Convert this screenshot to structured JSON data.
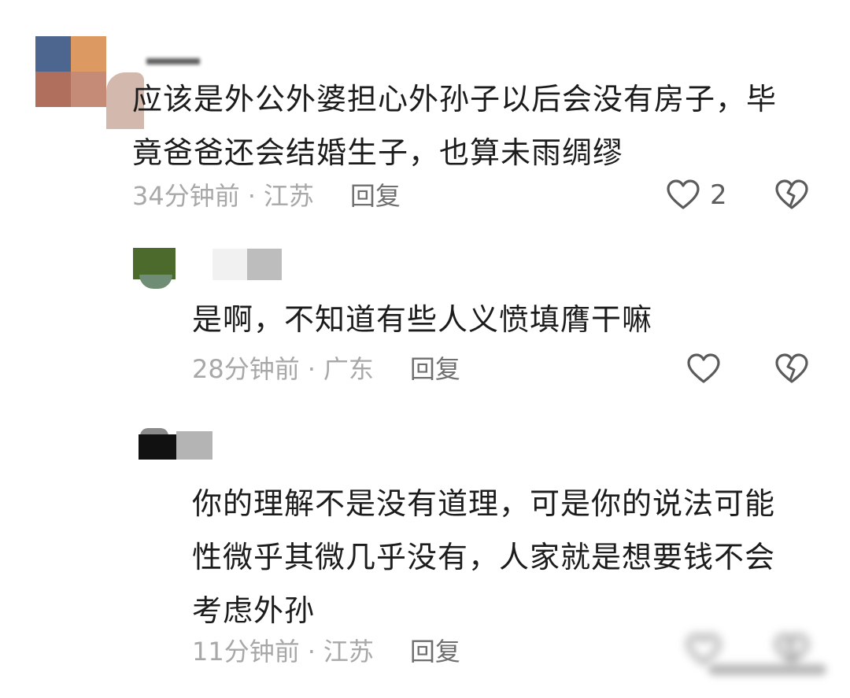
{
  "comments": [
    {
      "text_lines": [
        "应该是外公外婆担心外孙子以后会没有房子，毕",
        "竟爸爸还会结婚生子，也算未雨绸缪"
      ],
      "time": "34分钟前",
      "location": "江苏",
      "reply_label": "回复",
      "like_count": "2"
    },
    {
      "text_lines": [
        "是啊，不知道有些人义愤填膺干嘛"
      ],
      "time": "28分钟前",
      "location": "广东",
      "reply_label": "回复",
      "like_count": ""
    },
    {
      "text_lines": [
        "你的理解不是没有道理，可是你的说法可能",
        "性微乎其微几乎没有，人家就是想要钱不会",
        "考虑外孙"
      ],
      "time": "11分钟前",
      "location": "江苏",
      "reply_label": "回复",
      "like_count": ""
    }
  ],
  "separator": "·",
  "icons": {
    "like": "heart-outline-icon",
    "dislike": "broken-heart-icon"
  },
  "colors": {
    "text": "#1c1c1c",
    "meta": "#a8a8a8",
    "reply": "#6f6f6f",
    "icon": "#5b5b5b"
  }
}
